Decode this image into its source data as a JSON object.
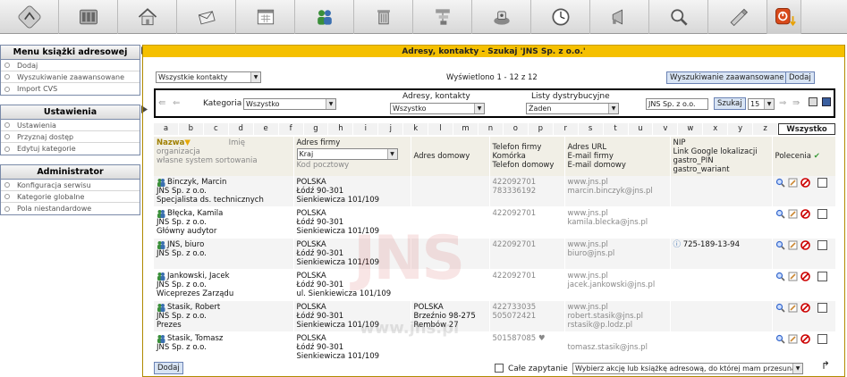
{
  "toolbar": {
    "icons": [
      "app-logo-icon",
      "server-icon",
      "home-icon",
      "mail-icon",
      "calendar-icon",
      "contacts-icon",
      "trash-icon",
      "network-icon",
      "phone-icon",
      "clock-icon",
      "announcement-icon",
      "search-icon",
      "settings-icon",
      "logout-icon"
    ]
  },
  "sidebar": {
    "menu_title": "Menu książki adresowej",
    "menu_items": [
      "Dodaj",
      "Wyszukiwanie zaawansowane",
      "Import CVS"
    ],
    "settings_title": "Ustawienia",
    "settings_items": [
      "Ustawienia",
      "Przyznaj dostęp",
      "Edytuj kategorie"
    ],
    "admin_title": "Administrator",
    "admin_items": [
      "Konfiguracja serwisu",
      "Kategorie globalne",
      "Pola niestandardowe"
    ]
  },
  "main": {
    "title": "Adresy, kontakty - Szukaj 'JNS Sp. z o.o.'",
    "contacts_select": "Wszystkie kontakty",
    "displayed": "Wyświetlono 1 - 12 z 12",
    "advanced_search_button": "Wyszukiwanie zaawansowane",
    "add_button": "Dodaj",
    "filter": {
      "category_label": "Kategoria",
      "category_value": "Wszystko",
      "addresses_label": "Adresy, kontakty",
      "addresses_value": "Wszystko",
      "lists_label": "Listy dystrybucyjne",
      "lists_value": "Żaden",
      "search_value": "JNS Sp. z o.o.",
      "search_button": "Szukaj",
      "per_page": "15"
    },
    "letters": [
      "a",
      "b",
      "c",
      "d",
      "e",
      "f",
      "g",
      "h",
      "i",
      "j",
      "k",
      "l",
      "m",
      "n",
      "o",
      "p",
      "r",
      "s",
      "t",
      "u",
      "v",
      "w",
      "x",
      "y",
      "z"
    ],
    "letters_all": "Wszystko",
    "headers": {
      "name": "Nazwa",
      "first_name": "Imię",
      "organization": "organizacja",
      "own_sort": "własne system sortowania",
      "company_address": "Adres firmy",
      "country_select": "Kraj",
      "postal_code": "Kod pocztowy",
      "home_address": "Adres domowy",
      "phones": "Telefon firmy\nKomórka\nTelefon domowy",
      "urls": "Adres URL\nE-mail firmy\nE-mail domowy",
      "nip": "NIP\nLink Google lokalizacji\ngastro_PIN\ngastro_wariant",
      "commands": "Polecenia"
    },
    "rows": [
      {
        "name": "Binczyk, Marcin",
        "org": "JNS Sp. z o.o.",
        "title": "Specjalista ds. technicznych",
        "country": "POLSKA",
        "city": "Łódź  90-301",
        "street": "Sienkiewicza 101/109",
        "home": "",
        "phone1": "422092701",
        "phone2": "783336192",
        "url": "www.jns.pl",
        "email": "marcin.binczyk@jns.pl",
        "email2": "",
        "nip": ""
      },
      {
        "name": "Błęcka, Kamila",
        "org": "JNS Sp. z o.o.",
        "title": "Główny audytor",
        "country": "POLSKA",
        "city": "Łódź  90-301",
        "street": "Sienkiewicza 101/109",
        "home": "",
        "phone1": "422092701",
        "phone2": "",
        "url": "www.jns.pl",
        "email": "kamila.blecka@jns.pl",
        "email2": "",
        "nip": ""
      },
      {
        "name": "JNS, biuro",
        "org": "JNS Sp. z o.o.",
        "title": "",
        "country": "POLSKA",
        "city": "Łódź  90-301",
        "street": "Sienkiewicza 101/109",
        "home": "",
        "phone1": "422092701",
        "phone2": "",
        "url": "www.jns.pl",
        "email": "biuro@jns.pl",
        "email2": "",
        "nip": "725-189-13-94"
      },
      {
        "name": "Jankowski, Jacek",
        "org": "JNS Sp. z o.o.",
        "title": "Wiceprezes Zarządu",
        "country": "POLSKA",
        "city": "Łódź  90-301",
        "street": "ul. Sienkiewicza 101/109",
        "home": "",
        "phone1": "422092701",
        "phone2": "",
        "url": "www.jns.pl",
        "email": "jacek.jankowski@jns.pl",
        "email2": "",
        "nip": ""
      },
      {
        "name": "Stasik, Robert",
        "org": "JNS Sp. z o.o.",
        "title": "Prezes",
        "country": "POLSKA",
        "city": "Łódź  90-301",
        "street": "Sienkiewicza 101/109",
        "home": "POLSKA\nBrzeźnio  98-275\nRembów 27",
        "phone1": "422733035",
        "phone2": "505072421",
        "url": "www.jns.pl",
        "email": "robert.stasik@jns.pl",
        "email2": "rstasik@p.lodz.pl",
        "nip": ""
      },
      {
        "name": "Stasik, Tomasz",
        "org": "JNS Sp. z o.o.",
        "title": "",
        "country": "POLSKA",
        "city": "Łódź  90-301",
        "street": "Sienkiewicza 101/109",
        "home": "",
        "phone1": "501587085 ♥",
        "phone2": "",
        "url": "",
        "email": "tomasz.stasik@jns.pl",
        "email2": "",
        "nip": ""
      }
    ],
    "bottom": {
      "add_button": "Dodaj",
      "whole_query_label": "Całe zapytanie",
      "action_select": "Wybierz akcję lub książkę adresową, do której mam przesunąć..."
    },
    "watermark": "JNS",
    "watermark_url": "www.jns.pl"
  },
  "colors": {
    "accent": "#f5c000",
    "button": "#d8e4f4",
    "header_bg": "#f1efe6"
  }
}
